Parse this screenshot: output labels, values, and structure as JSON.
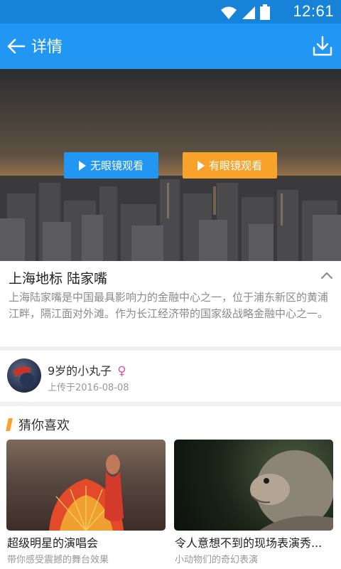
{
  "status_bar": {
    "time": "12:61",
    "icons": [
      "wifi-icon",
      "signal-icon",
      "battery-icon"
    ]
  },
  "app_bar": {
    "title": "详情",
    "back_icon": "arrow-left-icon",
    "download_icon": "download-icon"
  },
  "hero": {
    "btn_no_glasses": "无眼镜观看",
    "btn_with_glasses": "有眼镜观看",
    "colors": {
      "blue": "#2196f3",
      "orange": "#f7a22b"
    }
  },
  "video": {
    "title": "上海地标 陆家嘴",
    "description": "上海陆家嘴是中国最具影响力的金融中心之一，位于浦东新区的黄浦江畔，隔江面对外滩。作为长江经济带的国家级战略金融中心之一。"
  },
  "uploader": {
    "name": "9岁的小丸子",
    "gender_symbol": "♀",
    "date": "上传于2016-08-08"
  },
  "recommend": {
    "header": "猜你喜欢",
    "items": [
      {
        "title": "超级明星的演唱会",
        "subtitle": "带你感受震撼的舞台效果"
      },
      {
        "title": "令人意想不到的现场表演秀...",
        "subtitle": "小动物们的奇幻表演"
      }
    ]
  }
}
